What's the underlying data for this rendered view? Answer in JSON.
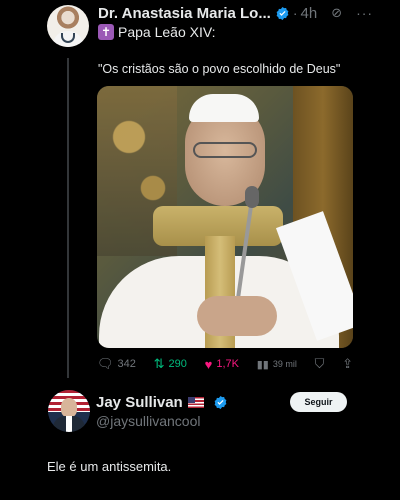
{
  "tweet": {
    "author_name": "Dr. Anastasia Maria Lo...",
    "time": "4h",
    "line2_text": "Papa Leão XIV:",
    "quote_text": "\"Os cristãos são o povo escolhido de Deus\"",
    "actions": {
      "replies": "342",
      "retweets": "290",
      "likes": "1,7K",
      "views": "39 mil"
    }
  },
  "reply": {
    "author_name": "Jay Sullivan",
    "handle": "@jaysullivancool",
    "follow_label": "Seguir",
    "text": "Ele é um antissemita."
  },
  "colors": {
    "background": "#000000",
    "verified_blue": "#1d9bf0",
    "retweet_green": "#00ba7c",
    "like_pink": "#f91880",
    "muted": "#71767b"
  }
}
